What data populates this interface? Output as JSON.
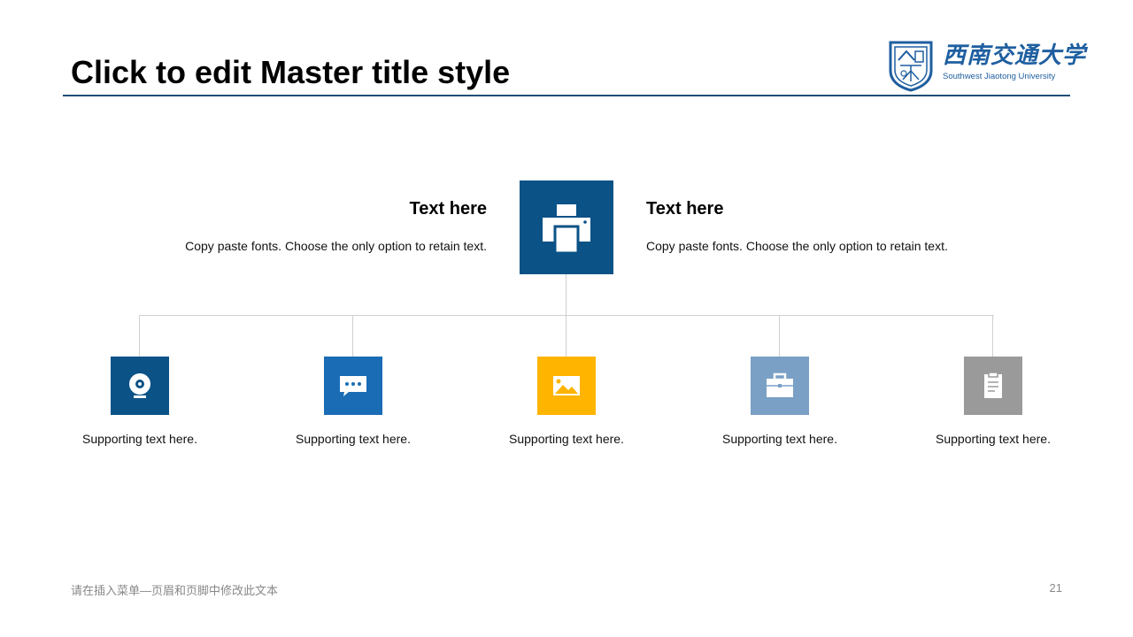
{
  "slide": {
    "title": "Click to edit Master title style",
    "page_number": "21",
    "footer_text": "请在插入菜单—页眉和页脚中修改此文本"
  },
  "logo": {
    "name_cn": "西南交通大学",
    "name_en": "Southwest Jiaotong University",
    "color": "#1f5fa0"
  },
  "diagram": {
    "main_node": {
      "icon": "printer-icon",
      "color": "#0b5286"
    },
    "left_text": {
      "heading": "Text here",
      "body": "Copy paste fonts. Choose the only option to retain text."
    },
    "right_text": {
      "heading": "Text here",
      "body": "Copy paste fonts. Choose the only option to retain text."
    },
    "children": [
      {
        "icon": "webcam-icon",
        "color": "#0b5286",
        "label": "Supporting text here."
      },
      {
        "icon": "chat-bubble-icon",
        "color": "#1a6cb5",
        "label": "Supporting text here."
      },
      {
        "icon": "image-icon",
        "color": "#ffb400",
        "label": "Supporting text here."
      },
      {
        "icon": "briefcase-icon",
        "color": "#7aa0c5",
        "label": "Supporting text here."
      },
      {
        "icon": "clipboard-icon",
        "color": "#9a9a9a",
        "label": "Supporting text here."
      }
    ]
  }
}
